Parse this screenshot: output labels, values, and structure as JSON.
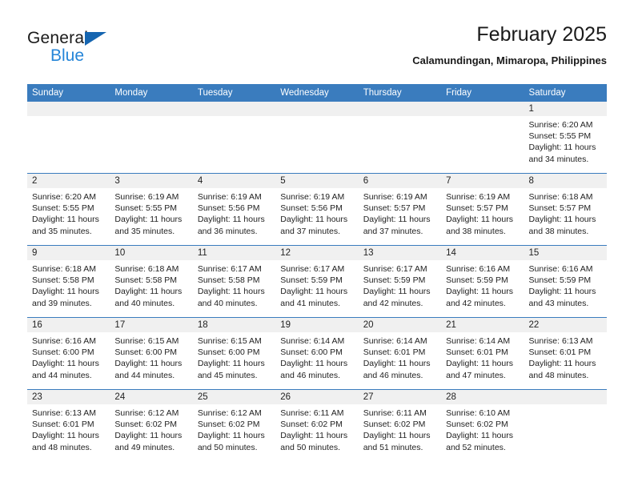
{
  "brand": {
    "name_top": "General",
    "name_bottom": "Blue",
    "triangle_color": "#1565b0",
    "blue_color": "#2585d8"
  },
  "header": {
    "title": "February 2025",
    "subtitle": "Calamundingan, Mimaropa, Philippines"
  },
  "theme": {
    "header_blue": "#3a7cbe",
    "daynum_band": "#f0f0f0"
  },
  "calendar": {
    "weekday_headers": [
      "Sunday",
      "Monday",
      "Tuesday",
      "Wednesday",
      "Thursday",
      "Friday",
      "Saturday"
    ],
    "weeks": [
      [
        {
          "day": "",
          "blank": true
        },
        {
          "day": "",
          "blank": true
        },
        {
          "day": "",
          "blank": true
        },
        {
          "day": "",
          "blank": true
        },
        {
          "day": "",
          "blank": true
        },
        {
          "day": "",
          "blank": true
        },
        {
          "day": "1",
          "sunrise": "Sunrise: 6:20 AM",
          "sunset": "Sunset: 5:55 PM",
          "daylight": "Daylight: 11 hours and 34 minutes."
        }
      ],
      [
        {
          "day": "2",
          "sunrise": "Sunrise: 6:20 AM",
          "sunset": "Sunset: 5:55 PM",
          "daylight": "Daylight: 11 hours and 35 minutes."
        },
        {
          "day": "3",
          "sunrise": "Sunrise: 6:19 AM",
          "sunset": "Sunset: 5:55 PM",
          "daylight": "Daylight: 11 hours and 35 minutes."
        },
        {
          "day": "4",
          "sunrise": "Sunrise: 6:19 AM",
          "sunset": "Sunset: 5:56 PM",
          "daylight": "Daylight: 11 hours and 36 minutes."
        },
        {
          "day": "5",
          "sunrise": "Sunrise: 6:19 AM",
          "sunset": "Sunset: 5:56 PM",
          "daylight": "Daylight: 11 hours and 37 minutes."
        },
        {
          "day": "6",
          "sunrise": "Sunrise: 6:19 AM",
          "sunset": "Sunset: 5:57 PM",
          "daylight": "Daylight: 11 hours and 37 minutes."
        },
        {
          "day": "7",
          "sunrise": "Sunrise: 6:19 AM",
          "sunset": "Sunset: 5:57 PM",
          "daylight": "Daylight: 11 hours and 38 minutes."
        },
        {
          "day": "8",
          "sunrise": "Sunrise: 6:18 AM",
          "sunset": "Sunset: 5:57 PM",
          "daylight": "Daylight: 11 hours and 38 minutes."
        }
      ],
      [
        {
          "day": "9",
          "sunrise": "Sunrise: 6:18 AM",
          "sunset": "Sunset: 5:58 PM",
          "daylight": "Daylight: 11 hours and 39 minutes."
        },
        {
          "day": "10",
          "sunrise": "Sunrise: 6:18 AM",
          "sunset": "Sunset: 5:58 PM",
          "daylight": "Daylight: 11 hours and 40 minutes."
        },
        {
          "day": "11",
          "sunrise": "Sunrise: 6:17 AM",
          "sunset": "Sunset: 5:58 PM",
          "daylight": "Daylight: 11 hours and 40 minutes."
        },
        {
          "day": "12",
          "sunrise": "Sunrise: 6:17 AM",
          "sunset": "Sunset: 5:59 PM",
          "daylight": "Daylight: 11 hours and 41 minutes."
        },
        {
          "day": "13",
          "sunrise": "Sunrise: 6:17 AM",
          "sunset": "Sunset: 5:59 PM",
          "daylight": "Daylight: 11 hours and 42 minutes."
        },
        {
          "day": "14",
          "sunrise": "Sunrise: 6:16 AM",
          "sunset": "Sunset: 5:59 PM",
          "daylight": "Daylight: 11 hours and 42 minutes."
        },
        {
          "day": "15",
          "sunrise": "Sunrise: 6:16 AM",
          "sunset": "Sunset: 5:59 PM",
          "daylight": "Daylight: 11 hours and 43 minutes."
        }
      ],
      [
        {
          "day": "16",
          "sunrise": "Sunrise: 6:16 AM",
          "sunset": "Sunset: 6:00 PM",
          "daylight": "Daylight: 11 hours and 44 minutes."
        },
        {
          "day": "17",
          "sunrise": "Sunrise: 6:15 AM",
          "sunset": "Sunset: 6:00 PM",
          "daylight": "Daylight: 11 hours and 44 minutes."
        },
        {
          "day": "18",
          "sunrise": "Sunrise: 6:15 AM",
          "sunset": "Sunset: 6:00 PM",
          "daylight": "Daylight: 11 hours and 45 minutes."
        },
        {
          "day": "19",
          "sunrise": "Sunrise: 6:14 AM",
          "sunset": "Sunset: 6:00 PM",
          "daylight": "Daylight: 11 hours and 46 minutes."
        },
        {
          "day": "20",
          "sunrise": "Sunrise: 6:14 AM",
          "sunset": "Sunset: 6:01 PM",
          "daylight": "Daylight: 11 hours and 46 minutes."
        },
        {
          "day": "21",
          "sunrise": "Sunrise: 6:14 AM",
          "sunset": "Sunset: 6:01 PM",
          "daylight": "Daylight: 11 hours and 47 minutes."
        },
        {
          "day": "22",
          "sunrise": "Sunrise: 6:13 AM",
          "sunset": "Sunset: 6:01 PM",
          "daylight": "Daylight: 11 hours and 48 minutes."
        }
      ],
      [
        {
          "day": "23",
          "sunrise": "Sunrise: 6:13 AM",
          "sunset": "Sunset: 6:01 PM",
          "daylight": "Daylight: 11 hours and 48 minutes."
        },
        {
          "day": "24",
          "sunrise": "Sunrise: 6:12 AM",
          "sunset": "Sunset: 6:02 PM",
          "daylight": "Daylight: 11 hours and 49 minutes."
        },
        {
          "day": "25",
          "sunrise": "Sunrise: 6:12 AM",
          "sunset": "Sunset: 6:02 PM",
          "daylight": "Daylight: 11 hours and 50 minutes."
        },
        {
          "day": "26",
          "sunrise": "Sunrise: 6:11 AM",
          "sunset": "Sunset: 6:02 PM",
          "daylight": "Daylight: 11 hours and 50 minutes."
        },
        {
          "day": "27",
          "sunrise": "Sunrise: 6:11 AM",
          "sunset": "Sunset: 6:02 PM",
          "daylight": "Daylight: 11 hours and 51 minutes."
        },
        {
          "day": "28",
          "sunrise": "Sunrise: 6:10 AM",
          "sunset": "Sunset: 6:02 PM",
          "daylight": "Daylight: 11 hours and 52 minutes."
        },
        {
          "day": "",
          "blank": true
        }
      ]
    ]
  }
}
